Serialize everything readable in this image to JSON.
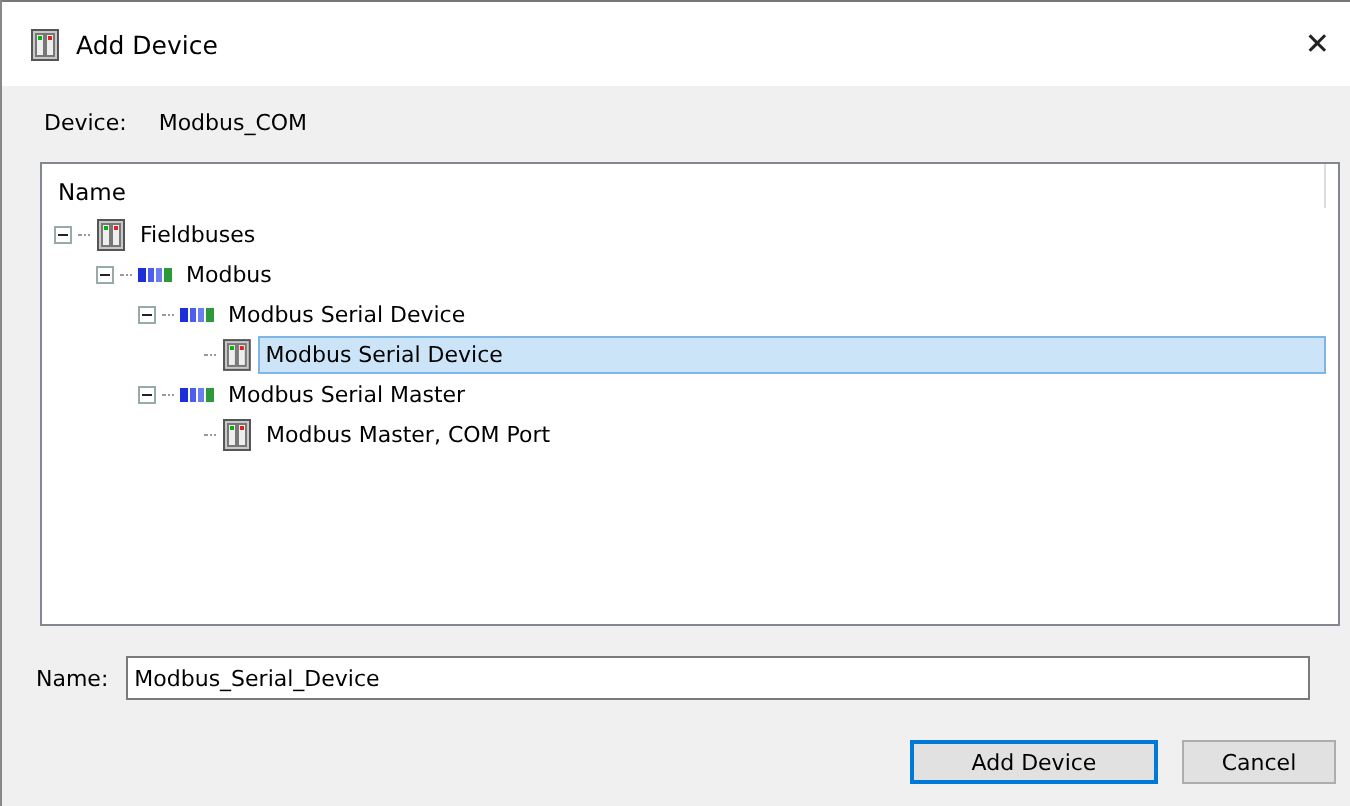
{
  "window": {
    "title": "Add Device",
    "close": "✕"
  },
  "device": {
    "label": "Device:",
    "value": "Modbus_COM"
  },
  "tree": {
    "header": "Name",
    "nodes": [
      {
        "label": "Fieldbuses",
        "kind": "device",
        "expanded": true,
        "selected": false,
        "children": [
          {
            "label": "Modbus",
            "kind": "bus",
            "expanded": true,
            "selected": false,
            "children": [
              {
                "label": "Modbus Serial Device",
                "kind": "bus",
                "expanded": true,
                "selected": false,
                "children": [
                  {
                    "label": "Modbus Serial Device",
                    "kind": "device",
                    "selected": true
                  }
                ]
              },
              {
                "label": "Modbus Serial Master",
                "kind": "bus",
                "expanded": true,
                "selected": false,
                "children": [
                  {
                    "label": "Modbus Master, COM Port",
                    "kind": "device",
                    "selected": false
                  }
                ]
              }
            ]
          }
        ]
      }
    ]
  },
  "name_field": {
    "label": "Name:",
    "value": "Modbus_Serial_Device"
  },
  "buttons": [
    {
      "label": "Add Device",
      "default": true
    },
    {
      "label": "Cancel",
      "default": false
    }
  ]
}
